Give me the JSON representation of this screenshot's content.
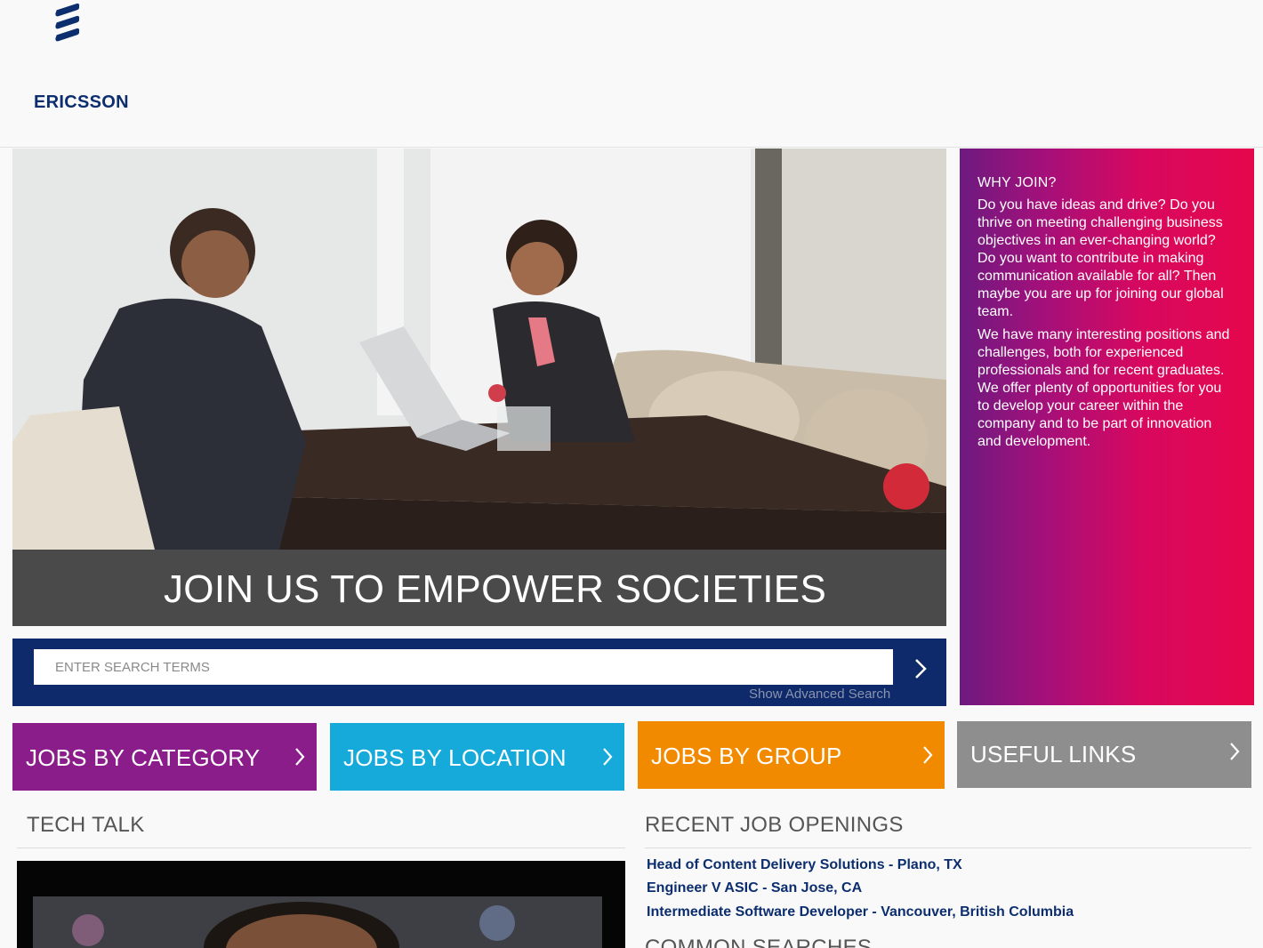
{
  "brand": {
    "name": "ERICSSON",
    "color": "#0c2e6e"
  },
  "hero": {
    "caption": "JOIN US TO EMPOWER SOCIETIES"
  },
  "why_join": {
    "title": "WHY JOIN?",
    "paragraphs": [
      "Do you have ideas and drive? Do you thrive on meeting challenging business objectives in an ever-changing world? Do you want to contribute in making communication available for all? Then maybe you are up for joining our global team.",
      "We have many interesting positions and challenges, both for experienced professionals and for recent graduates. We offer plenty of opportunities for you to develop your career within the company and to be part of innovation and development."
    ]
  },
  "search": {
    "placeholder": "ENTER SEARCH TERMS",
    "advanced_label": "Show Advanced Search",
    "go_icon": "chevron-right-icon"
  },
  "tiles": [
    {
      "label": "JOBS BY CATEGORY",
      "color": "#8b1d8b",
      "icon": "chevron-right-icon"
    },
    {
      "label": "JOBS BY LOCATION",
      "color": "#16aadb",
      "icon": "chevron-right-icon"
    },
    {
      "label": "JOBS BY GROUP",
      "color": "#f28a00",
      "icon": "chevron-right-icon"
    },
    {
      "label": "USEFUL LINKS",
      "color": "#8e8e8e",
      "icon": "chevron-right-icon"
    }
  ],
  "tech_talk": {
    "title": "TECH TALK"
  },
  "recent_jobs": {
    "title": "RECENT JOB OPENINGS",
    "items": [
      "Head of Content Delivery Solutions - Plano, TX",
      "Engineer V ASIC - San Jose, CA",
      "Intermediate Software Developer - Vancouver, British Columbia"
    ]
  },
  "common_searches": {
    "title": "COMMON SEARCHES"
  }
}
